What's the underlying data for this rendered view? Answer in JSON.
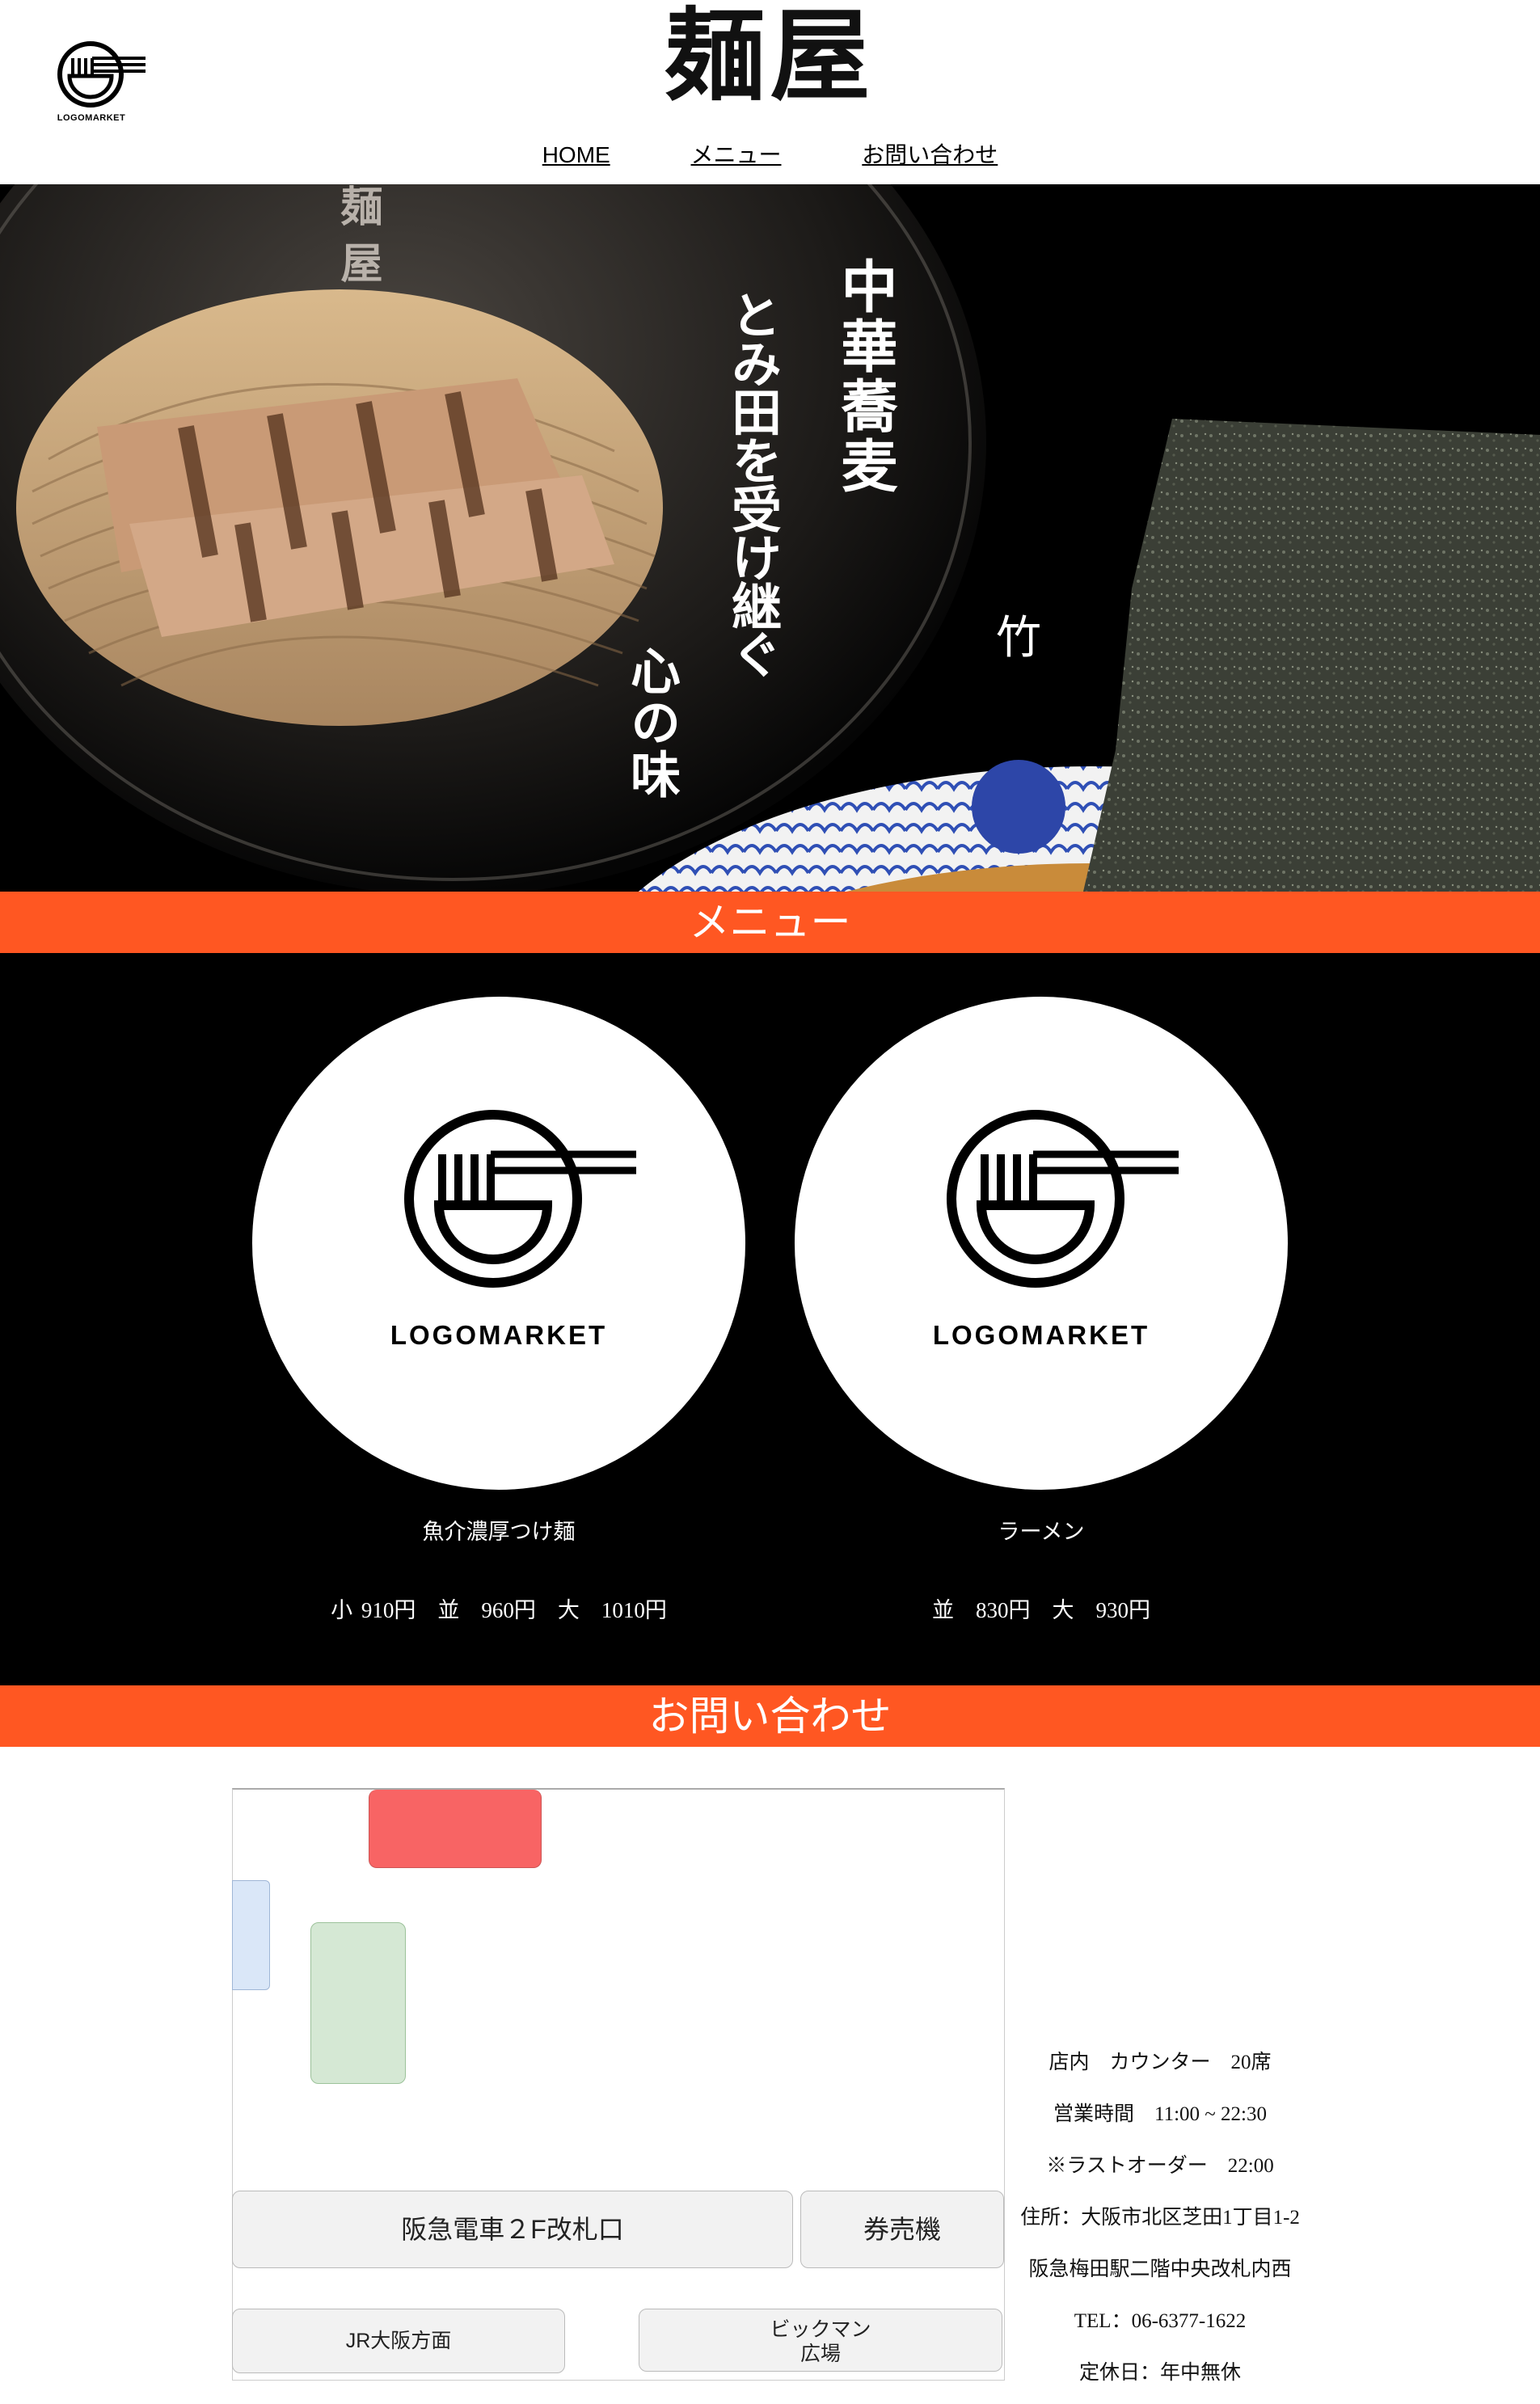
{
  "header": {
    "logo_caption": "LOGOMARKET",
    "brand_title": "麺屋",
    "nav": [
      {
        "label": "HOME"
      },
      {
        "label": "メニュー"
      },
      {
        "label": "お問い合わせ"
      }
    ]
  },
  "hero": {
    "bowl_text": "麺 屋",
    "text_col1": "中華蕎麦",
    "text_col2": "とみ田を受け継ぐ",
    "text_col3": "心の味",
    "bowl_badge": "竹"
  },
  "menu_section": {
    "heading": "メニュー",
    "items": [
      {
        "logo_caption": "LOGOMARKET",
        "name": "魚介濃厚つけ麺",
        "price": "小 910円　並　960円　大　1010円"
      },
      {
        "logo_caption": "LOGOMARKET",
        "name": "ラーメン",
        "price": "並　830円　大　930円"
      }
    ]
  },
  "contact_section": {
    "heading": "お問い合わせ",
    "map": {
      "gate_label": "阪急電車２F改札口",
      "ticket_label": "券売機",
      "jr_label": "JR大阪方面",
      "bigman_label": "ビックマン広場"
    },
    "info": [
      "店内　カウンター　20席",
      "営業時間　11:00 ~ 22:30",
      "※ラストオーダー　22:00",
      "住所：大阪市北区芝田1丁目1-2",
      "阪急梅田駅二階中央改札内西",
      "TEL：06-6377-1622",
      "定休日：年中無休"
    ]
  },
  "colors": {
    "accent": "#ff5722",
    "map_red": "#f86464",
    "map_blue": "#dae7f8",
    "map_green": "#d5e8d4"
  }
}
